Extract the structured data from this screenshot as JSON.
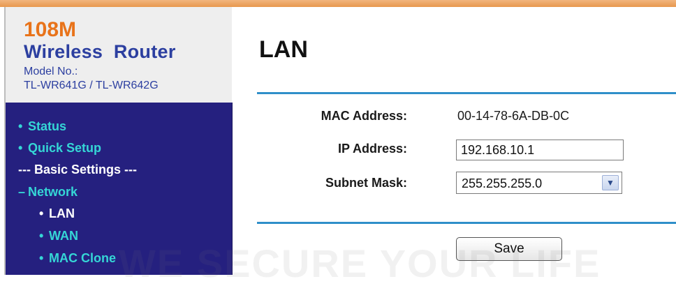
{
  "brand": {
    "speed": "108M",
    "product": "Wireless  Router",
    "model_label": "Model No.:",
    "model_value": "TL-WR641G / TL-WR642G"
  },
  "menu": [
    {
      "label": "Status",
      "bullet": "•",
      "level": 0
    },
    {
      "label": "Quick Setup",
      "bullet": "•",
      "level": 0
    },
    {
      "label": "--- Basic Settings ---",
      "bullet": "",
      "level": 0
    },
    {
      "label": "Network",
      "bullet": "–",
      "level": 0
    },
    {
      "label": "LAN",
      "bullet": "•",
      "level": 1
    },
    {
      "label": "WAN",
      "bullet": "•",
      "level": 1
    },
    {
      "label": "MAC Clone",
      "bullet": "•",
      "level": 1
    }
  ],
  "page": {
    "title": "LAN",
    "mac_label": "MAC Address:",
    "mac_value": "00-14-78-6A-DB-0C",
    "ip_label": "IP Address:",
    "ip_value": "192.168.10.1",
    "mask_label": "Subnet Mask:",
    "mask_value": "255.255.255.0",
    "save_label": "Save"
  },
  "watermark": "WE SECURE YOUR LIFE",
  "colors": {
    "menu_bg": "#25207f",
    "menu_link": "#35d6d6",
    "accent_orange": "#e8731a",
    "brand_blue": "#2c3fa0",
    "rule_blue": "#2f8fc9"
  }
}
